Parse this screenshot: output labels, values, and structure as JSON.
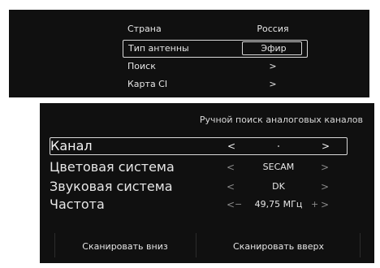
{
  "top_menu": {
    "items": [
      {
        "label": "Страна",
        "value": "Россия"
      },
      {
        "label": "Тип антенны",
        "value": "Эфир"
      },
      {
        "label": "Поиск",
        "value": ">"
      },
      {
        "label": "Карта CI",
        "value": ">"
      }
    ]
  },
  "manual_search": {
    "title": "Ручной поиск аналоговых каналов",
    "rows": [
      {
        "label": "Канал",
        "left_arrow": "<",
        "value": "",
        "right_arrow": ">"
      },
      {
        "label": "Цветовая система",
        "left_arrow": "<",
        "value": "SECAM",
        "right_arrow": ">"
      },
      {
        "label": "Звуковая система",
        "left_arrow": "<",
        "value": "DK",
        "right_arrow": ">"
      },
      {
        "label": "Частота",
        "left_arrow": "<",
        "minus": "−",
        "value": "49,75 МГц",
        "plus": "+",
        "right_arrow": ">"
      }
    ],
    "scan_down": "Сканировать вниз",
    "scan_up": "Сканировать вверх"
  }
}
